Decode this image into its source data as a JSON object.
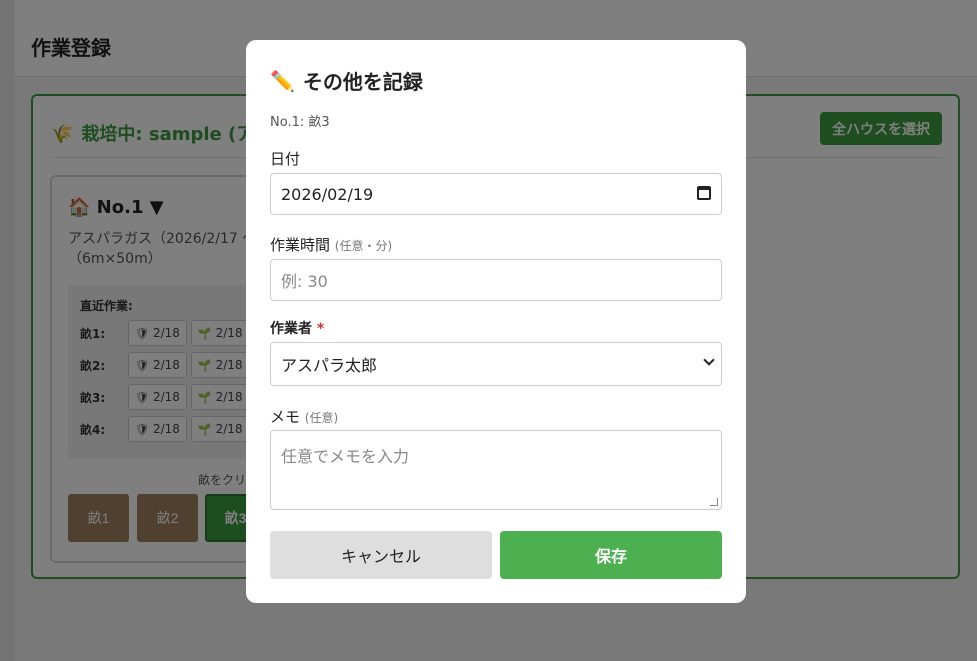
{
  "page": {
    "title": "作業登録",
    "crop_header": "栽培中: sample (アス",
    "crop_leaf_icon": "🌾",
    "select_all_label": "全ハウスを選択",
    "house": {
      "name": "🏠 No.1 ▼",
      "desc_line1": "アスパラガス（2026/2/17 〜",
      "desc_line2": "（6m×50m）",
      "recent_title": "直近作業:",
      "rows": [
        {
          "label": "畝1:",
          "chip1": "2/18",
          "chip2": "2/18"
        },
        {
          "label": "畝2:",
          "chip1": "2/18",
          "chip2": "2/18"
        },
        {
          "label": "畝3:",
          "chip1": "2/18",
          "chip2": "2/18"
        },
        {
          "label": "畝4:",
          "chip1": "2/18",
          "chip2": "2/18"
        }
      ],
      "chip1_icon": "🛡",
      "chip2_icon": "🌱",
      "hint": "畝をクリ",
      "plots": [
        "畝1",
        "畝2",
        "畝3"
      ]
    }
  },
  "modal": {
    "title_icon": "✏️",
    "title": "その他を記録",
    "subtitle": "No.1: 畝3",
    "date_label": "日付",
    "date_value": "2026/02/19",
    "time_label": "作業時間",
    "time_optional": "(任意・分)",
    "time_placeholder": "例: 30",
    "worker_label": "作業者",
    "worker_required": "*",
    "worker_value": "アスパラ太郎",
    "memo_label": "メモ",
    "memo_optional": "(任意)",
    "memo_placeholder": "任意でメモを入力",
    "cancel_label": "キャンセル",
    "save_label": "保存"
  }
}
